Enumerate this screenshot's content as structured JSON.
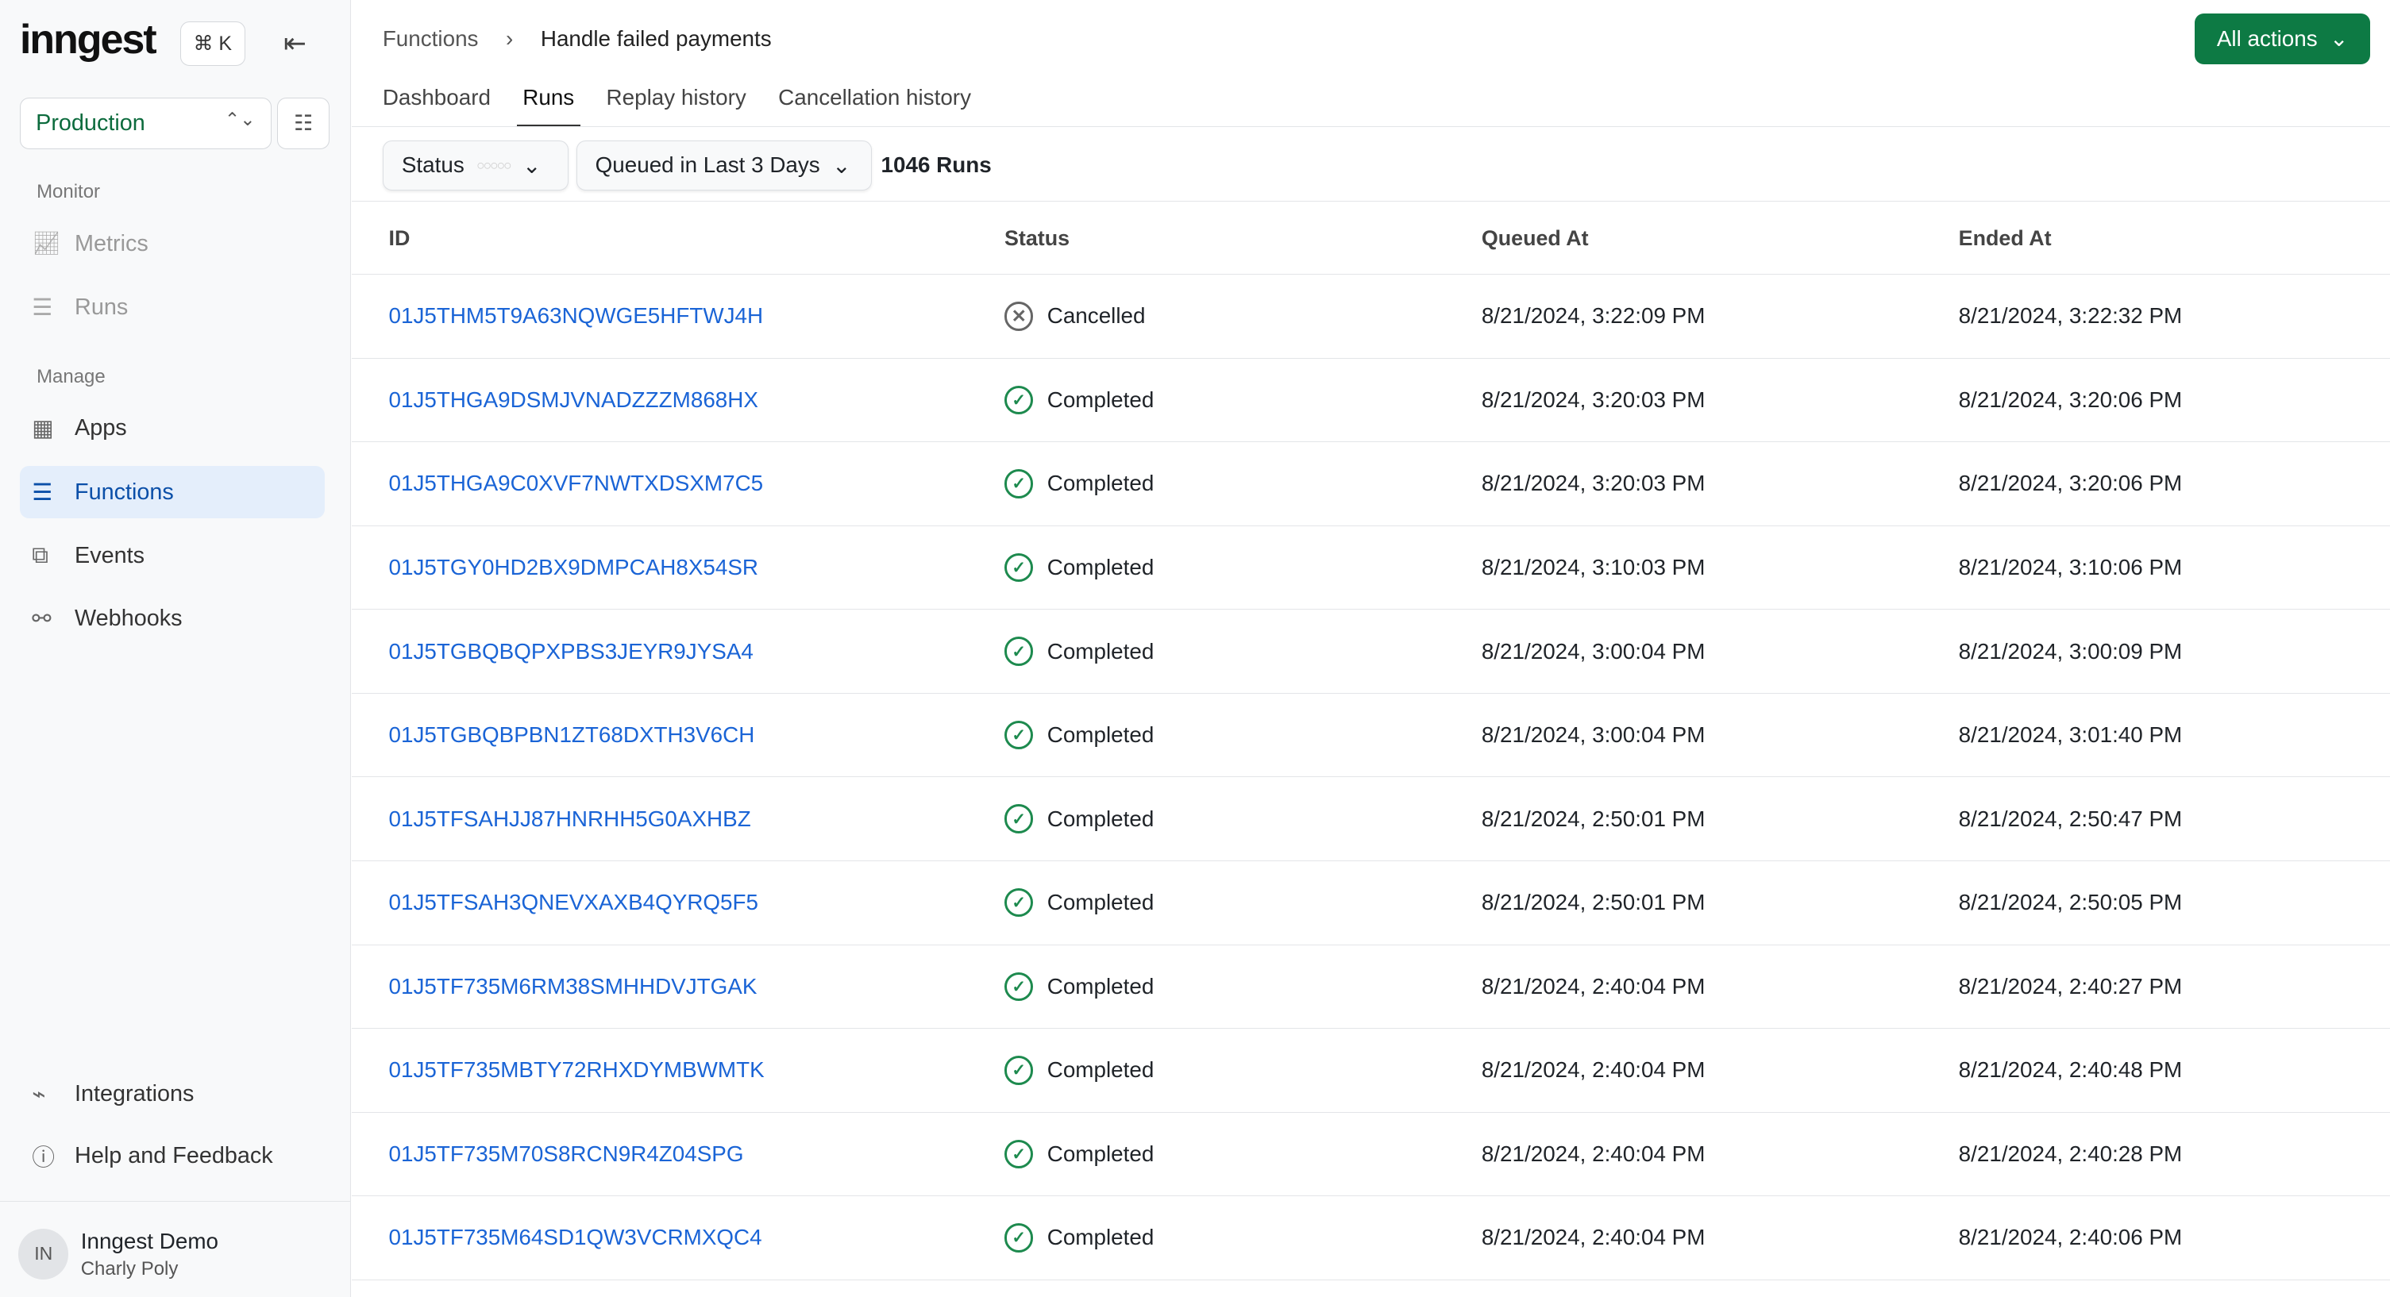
{
  "sidebar": {
    "logo": "inngest",
    "shortcut": "⌘ K",
    "environment": "Production",
    "sections": {
      "monitor": "Monitor",
      "manage": "Manage"
    },
    "items": [
      {
        "label": "Metrics",
        "icon": "chart-icon"
      },
      {
        "label": "Runs",
        "icon": "list-icon"
      },
      {
        "label": "Apps",
        "icon": "apps-icon"
      },
      {
        "label": "Functions",
        "icon": "functions-icon"
      },
      {
        "label": "Events",
        "icon": "events-icon"
      },
      {
        "label": "Webhooks",
        "icon": "webhook-icon"
      },
      {
        "label": "Integrations",
        "icon": "plug-icon"
      },
      {
        "label": "Help and Feedback",
        "icon": "help-icon"
      }
    ],
    "user": {
      "initials": "IN",
      "name": "Inngest Demo",
      "org": "Charly Poly"
    }
  },
  "header": {
    "breadcrumb": [
      "Functions",
      "Handle failed payments"
    ],
    "all_actions": "All actions"
  },
  "tabs": [
    "Dashboard",
    "Runs",
    "Replay history",
    "Cancellation history"
  ],
  "filters": {
    "status": "Status",
    "time": "Queued in Last 3 Days",
    "count": "1046 Runs"
  },
  "table": {
    "columns": [
      "ID",
      "Status",
      "Queued At",
      "Ended At"
    ],
    "rows": [
      {
        "id": "01J5THM5T9A63NQWGE5HFTWJ4H",
        "status": "Cancelled",
        "queued": "8/21/2024, 3:22:09 PM",
        "ended": "8/21/2024, 3:22:32 PM"
      },
      {
        "id": "01J5THGA9DSMJVNADZZZM868HX",
        "status": "Completed",
        "queued": "8/21/2024, 3:20:03 PM",
        "ended": "8/21/2024, 3:20:06 PM"
      },
      {
        "id": "01J5THGA9C0XVF7NWTXDSXM7C5",
        "status": "Completed",
        "queued": "8/21/2024, 3:20:03 PM",
        "ended": "8/21/2024, 3:20:06 PM"
      },
      {
        "id": "01J5TGY0HD2BX9DMPCAH8X54SR",
        "status": "Completed",
        "queued": "8/21/2024, 3:10:03 PM",
        "ended": "8/21/2024, 3:10:06 PM"
      },
      {
        "id": "01J5TGBQBQPXPBS3JEYR9JYSA4",
        "status": "Completed",
        "queued": "8/21/2024, 3:00:04 PM",
        "ended": "8/21/2024, 3:00:09 PM"
      },
      {
        "id": "01J5TGBQBPBN1ZT68DXTH3V6CH",
        "status": "Completed",
        "queued": "8/21/2024, 3:00:04 PM",
        "ended": "8/21/2024, 3:01:40 PM"
      },
      {
        "id": "01J5TFSAHJJ87HNRHH5G0AXHBZ",
        "status": "Completed",
        "queued": "8/21/2024, 2:50:01 PM",
        "ended": "8/21/2024, 2:50:47 PM"
      },
      {
        "id": "01J5TFSAH3QNEVXAXB4QYRQ5F5",
        "status": "Completed",
        "queued": "8/21/2024, 2:50:01 PM",
        "ended": "8/21/2024, 2:50:05 PM"
      },
      {
        "id": "01J5TF735M6RM38SMHHDVJTGAK",
        "status": "Completed",
        "queued": "8/21/2024, 2:40:04 PM",
        "ended": "8/21/2024, 2:40:27 PM"
      },
      {
        "id": "01J5TF735MBTY72RHXDYMBWMTK",
        "status": "Completed",
        "queued": "8/21/2024, 2:40:04 PM",
        "ended": "8/21/2024, 2:40:48 PM"
      },
      {
        "id": "01J5TF735M70S8RCN9R4Z04SPG",
        "status": "Completed",
        "queued": "8/21/2024, 2:40:04 PM",
        "ended": "8/21/2024, 2:40:28 PM"
      },
      {
        "id": "01J5TF735M64SD1QW3VCRMXQC4",
        "status": "Completed",
        "queued": "8/21/2024, 2:40:04 PM",
        "ended": "8/21/2024, 2:40:06 PM"
      }
    ]
  },
  "colors": {
    "accent": "#0d7a44",
    "link": "#1a64d6",
    "active_nav": "#e4eefb"
  }
}
